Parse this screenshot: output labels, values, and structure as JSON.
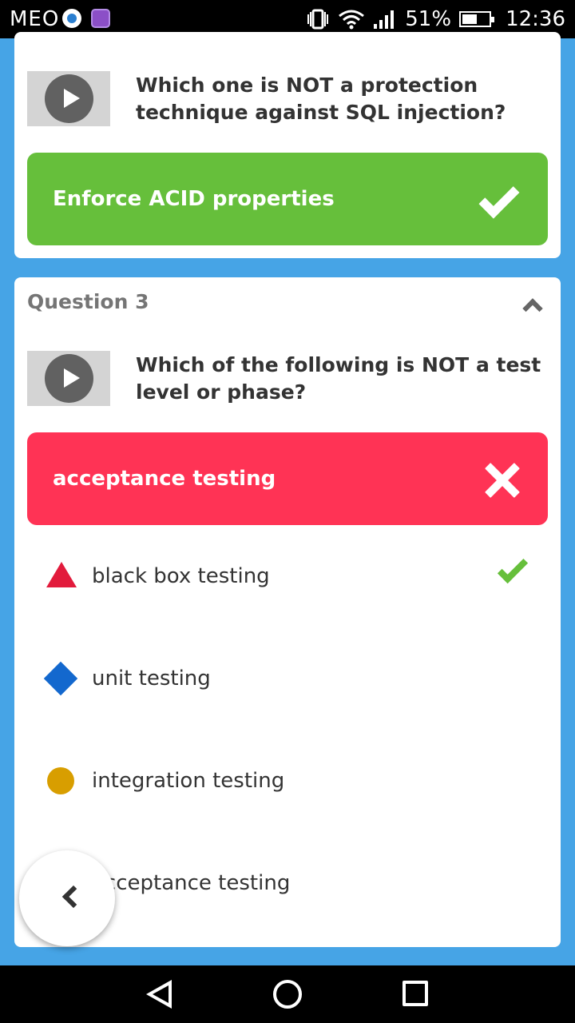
{
  "status_bar": {
    "carrier": "MEO",
    "battery": "51%",
    "time": "12:36"
  },
  "previous_question": {
    "question": "Which one is NOT a protection technique against SQL injection?",
    "selected_answer": "Enforce ACID properties",
    "result": "correct"
  },
  "question_3": {
    "label": "Question 3",
    "question": "Which of the following is NOT a test level or phase?",
    "selected_answer": "acceptance testing",
    "result": "incorrect",
    "options": [
      {
        "shape": "triangle",
        "color": "#e21b3c",
        "label": "black box testing",
        "correct": true
      },
      {
        "shape": "diamond",
        "color": "#1368ce",
        "label": "unit testing",
        "correct": false
      },
      {
        "shape": "circle",
        "color": "#d89e00",
        "label": "integration testing",
        "correct": false
      },
      {
        "shape": "square",
        "color": "#26890c",
        "label": "acceptance testing",
        "correct": false
      }
    ]
  },
  "colors": {
    "background": "#46a4e6",
    "correct": "#66bf3b",
    "incorrect": "#ff3355"
  },
  "icons": {
    "play": "play-icon",
    "correct": "check-icon",
    "incorrect": "x-icon",
    "collapse": "chevron-up-icon",
    "back": "chevron-left-icon"
  }
}
